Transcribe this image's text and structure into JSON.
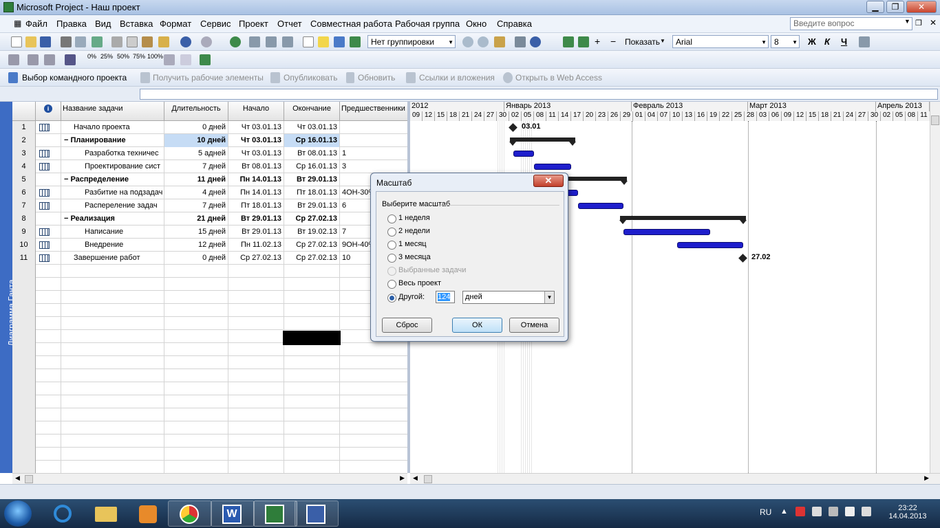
{
  "window": {
    "title": "Microsoft Project - Наш проект",
    "min": "▁",
    "max": "❐",
    "close": "✕"
  },
  "menu": [
    "Файл",
    "Правка",
    "Вид",
    "Вставка",
    "Формат",
    "Сервис",
    "Проект",
    "Отчет",
    "Совместная работа",
    "Рабочая группа",
    "Окно",
    "Справка"
  ],
  "help_placeholder": "Введите вопрос",
  "toolbar1": {
    "grouping": "Нет группировки",
    "show": "Показать",
    "font": "Arial",
    "size": "8",
    "bold": "Ж",
    "italic": "К",
    "underline": "Ч"
  },
  "toolbar2": {
    "pct": [
      "0%",
      "25%",
      "50%",
      "75%",
      "100%"
    ]
  },
  "toolbar3": {
    "team": "Выбор командного проекта",
    "get": "Получить рабочие элементы",
    "publish": "Опубликовать",
    "refresh": "Обновить",
    "links": "Ссылки и вложения",
    "web": "Открыть в Web Access"
  },
  "view_bar": "Диаграмма Ганта",
  "columns": {
    "info": "i",
    "name": "Название задачи",
    "dur": "Длительность",
    "start": "Начало",
    "finish": "Окончание",
    "pred": "Предшественники"
  },
  "tasks": [
    {
      "id": "1",
      "name": "Начало проекта",
      "dur": "0 дней",
      "start": "Чт 03.01.13",
      "finish": "Чт 03.01.13",
      "pred": "",
      "level": 1,
      "summary": false
    },
    {
      "id": "2",
      "name": "Планирование",
      "dur": "10 дней",
      "start": "Чт 03.01.13",
      "finish": "Ср 16.01.13",
      "pred": "",
      "level": 0,
      "summary": true
    },
    {
      "id": "3",
      "name": "Разработка техничес",
      "dur": "5 адней",
      "start": "Чт 03.01.13",
      "finish": "Вт 08.01.13",
      "pred": "1",
      "level": 2,
      "summary": false
    },
    {
      "id": "4",
      "name": "Проектирование сист",
      "dur": "7 дней",
      "start": "Вт 08.01.13",
      "finish": "Ср 16.01.13",
      "pred": "3",
      "level": 2,
      "summary": false
    },
    {
      "id": "5",
      "name": "Распределение",
      "dur": "11 дней",
      "start": "Пн 14.01.13",
      "finish": "Вт 29.01.13",
      "pred": "",
      "level": 0,
      "summary": true
    },
    {
      "id": "6",
      "name": "Разбитие на подзадач",
      "dur": "4 дней",
      "start": "Пн 14.01.13",
      "finish": "Пт 18.01.13",
      "pred": "4ОН-30%",
      "level": 2,
      "summary": false
    },
    {
      "id": "7",
      "name": "Распереление задач",
      "dur": "7 дней",
      "start": "Пт 18.01.13",
      "finish": "Вт 29.01.13",
      "pred": "6",
      "level": 2,
      "summary": false
    },
    {
      "id": "8",
      "name": "Реализация",
      "dur": "21 дней",
      "start": "Вт 29.01.13",
      "finish": "Ср 27.02.13",
      "pred": "",
      "level": 0,
      "summary": true
    },
    {
      "id": "9",
      "name": "Написание",
      "dur": "15 дней",
      "start": "Вт 29.01.13",
      "finish": "Вт 19.02.13",
      "pred": "7",
      "level": 2,
      "summary": false
    },
    {
      "id": "10",
      "name": "Внедрение",
      "dur": "12 дней",
      "start": "Пн 11.02.13",
      "finish": "Ср 27.02.13",
      "pred": "9ОН-40%",
      "level": 2,
      "summary": false
    },
    {
      "id": "11",
      "name": "Завершение работ",
      "dur": "0 дней",
      "start": "Ср 27.02.13",
      "finish": "Ср 27.02.13",
      "pred": "10",
      "level": 1,
      "summary": false
    }
  ],
  "timescale": {
    "months": [
      "2012",
      "Январь 2013",
      "Февраль 2013",
      "Март 2013",
      "Апрель 2013"
    ],
    "days": [
      "09",
      "12",
      "15",
      "18",
      "21",
      "24",
      "27",
      "30",
      "02",
      "05",
      "08",
      "11",
      "14",
      "17",
      "20",
      "23",
      "26",
      "29",
      "01",
      "04",
      "07",
      "10",
      "13",
      "16",
      "19",
      "22",
      "25",
      "28",
      "03",
      "06",
      "09",
      "12",
      "15",
      "18",
      "21",
      "24",
      "27",
      "30",
      "02",
      "05",
      "08",
      "11"
    ]
  },
  "milestones": {
    "start": "03.01",
    "end": "27.02"
  },
  "dialog": {
    "title": "Масштаб",
    "close": "✕",
    "group": "Выберите масштаб",
    "options": [
      "1 неделя",
      "2 недели",
      "1 месяц",
      "3 месяца",
      "Выбранные задачи",
      "Весь проект",
      "Другой:"
    ],
    "selected": 6,
    "custom_value": "124",
    "custom_unit": "дней",
    "reset": "Сброс",
    "ok": "ОК",
    "cancel": "Отмена"
  },
  "taskbar": {
    "lang": "RU",
    "time": "23:22",
    "date": "14.04.2013"
  }
}
